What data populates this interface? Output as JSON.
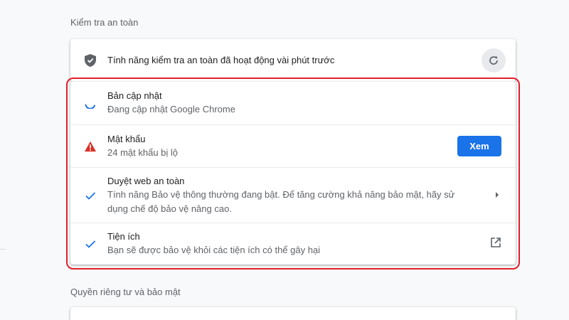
{
  "safety_check": {
    "section_title": "Kiểm tra an toàn",
    "status_text": "Tính năng kiểm tra an toàn đã hoạt động vài phút trước",
    "items": [
      {
        "title": "Bản cập nhật",
        "subtitle": "Đang cập nhật Google Chrome",
        "icon": "loading-spinner-icon"
      },
      {
        "title": "Mật khẩu",
        "subtitle": "24 mật khẩu bị lộ",
        "icon": "warning-triangle-icon",
        "action_label": "Xem"
      },
      {
        "title": "Duyệt web an toàn",
        "subtitle": "Tính năng Bảo vệ thông thường đang bật. Để tăng cường khả năng bảo mật, hãy sử dụng chế độ bảo vệ nâng cao.",
        "icon": "checkmark-icon"
      },
      {
        "title": "Tiện ích",
        "subtitle": "Bạn sẽ được bảo vệ khỏi các tiện ích có thể gây hại",
        "icon": "checkmark-icon"
      }
    ]
  },
  "privacy": {
    "section_title": "Quyền riêng tư và bảo mật"
  },
  "colors": {
    "accent": "#1a73e8",
    "warning": "#d93025",
    "highlight": "#e0202a"
  }
}
